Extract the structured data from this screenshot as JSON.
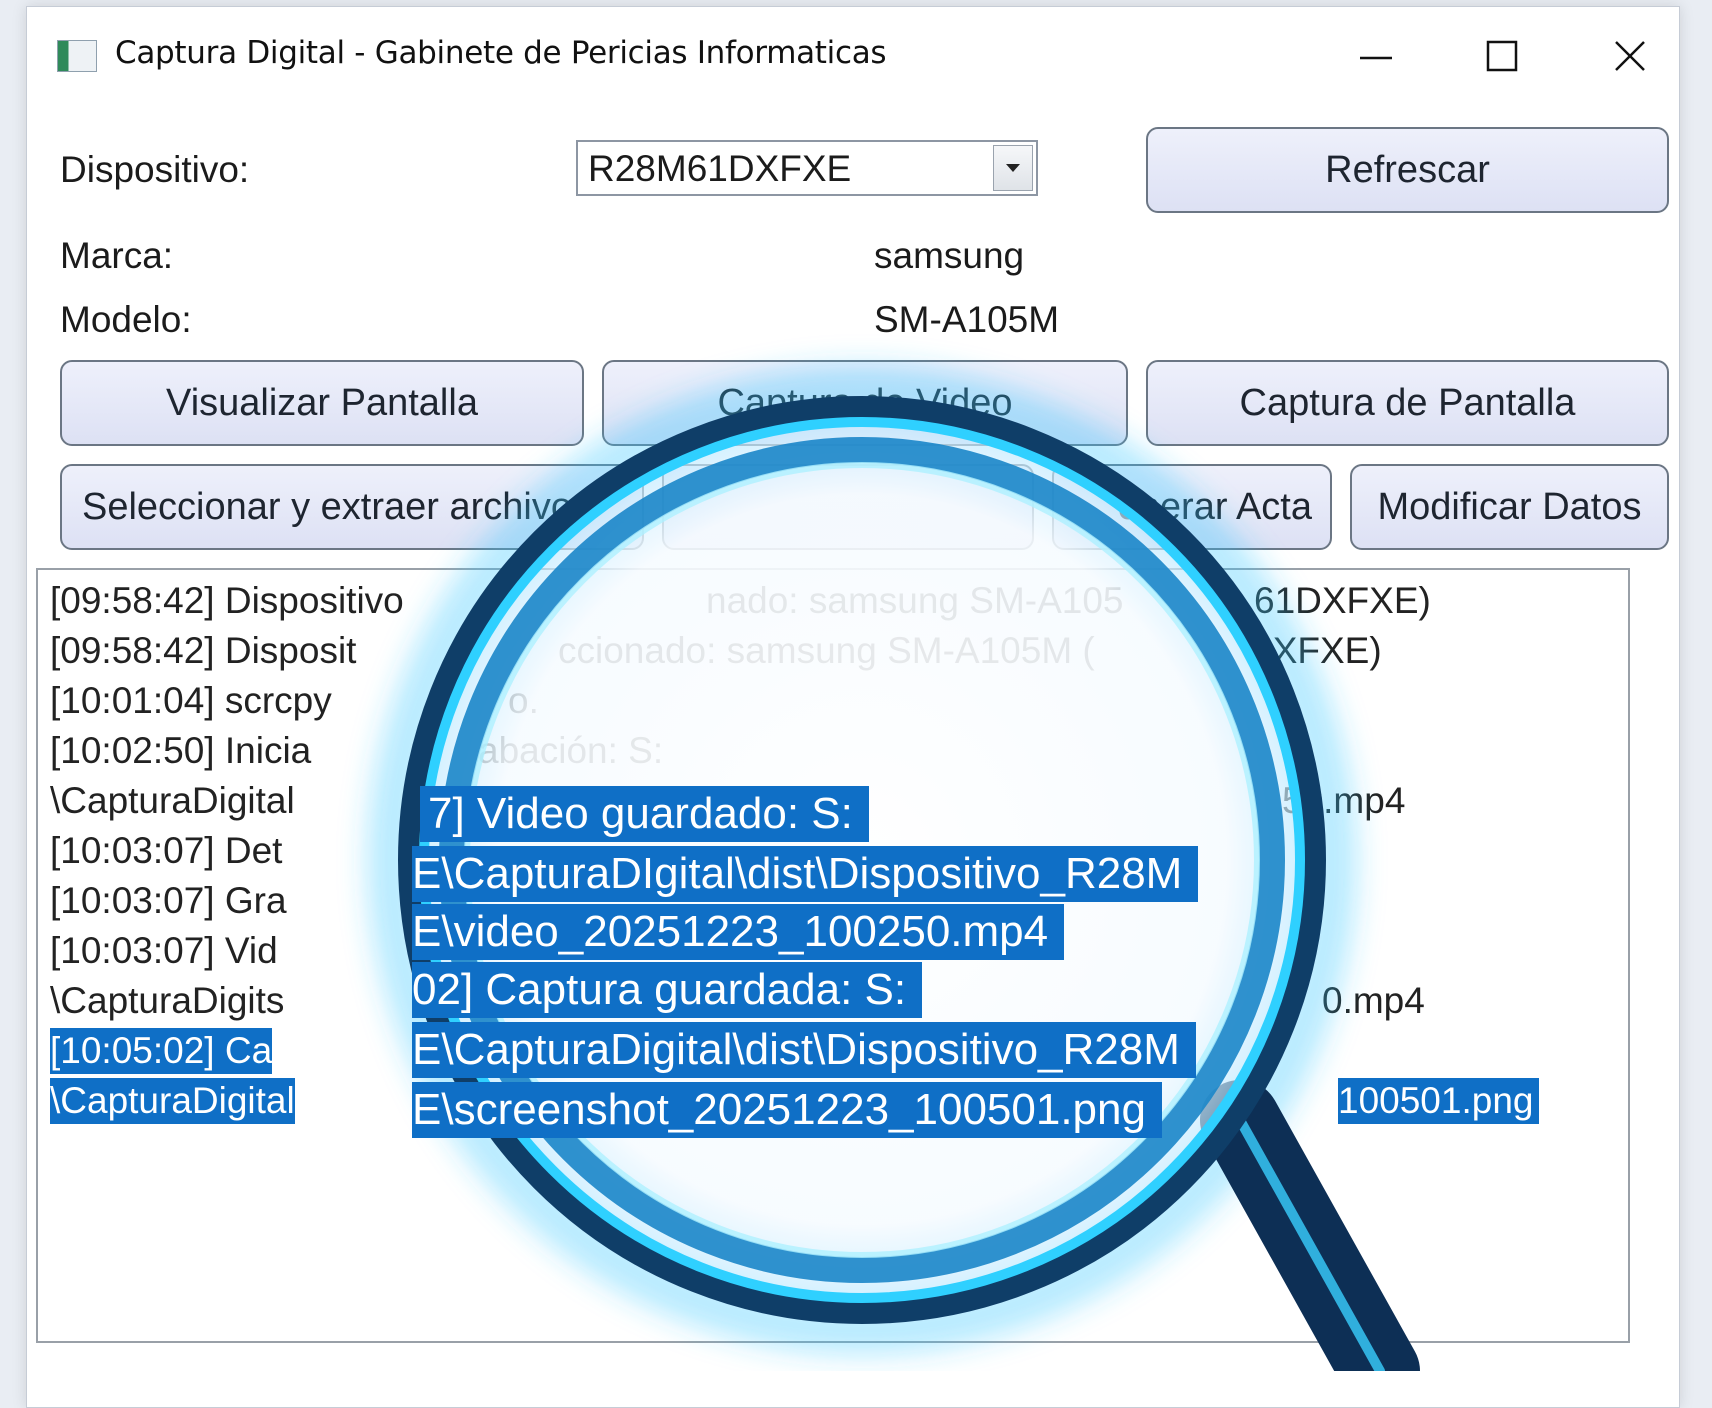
{
  "window": {
    "title": "Captura Digital - Gabinete de Pericias Informaticas"
  },
  "device": {
    "label": "Dispositivo:",
    "selected": "R28M61DXFXE",
    "refresh_label": "Refrescar"
  },
  "brand": {
    "label": "Marca:",
    "value": "samsung"
  },
  "model": {
    "label": "Modelo:",
    "value": "SM-A105M"
  },
  "actions_row1": {
    "view_screen": "Visualizar Pantalla",
    "video_capture": "Captura de Video",
    "screen_capture": "Captura de Pantalla"
  },
  "actions_row2": {
    "select_extract": "Seleccionar y extraer archivo",
    "generate_act": "enerar Acta",
    "modify_data": "Modificar Datos"
  },
  "log": {
    "lines": [
      "[09:58:42] Dispositivo",
      "nado: samsung SM-A105",
      "61DXFXE)",
      "[09:58:42] Disposit",
      "ccionado: samsung SM-A105M (",
      "DXFXE)",
      "[10:01:04] scrcpy",
      "o.",
      "[10:02:50] Inicia",
      "abación: S:",
      "\\CapturaDigital",
      "50.mp4",
      "[10:03:07] Det",
      "[10:03:07] Gra",
      "[10:03:07] Vid",
      "\\CapturaDigits",
      "0.mp4",
      "[10:05:02] Ca",
      "\\CapturaDigital",
      "100501.png"
    ],
    "magnified": [
      "7] Video guardado: S:",
      "E\\CapturaDIgital\\dist\\Dispositivo_R28M",
      "E\\video_20251223_100250.mp4",
      "02] Captura guardada: S:",
      "E\\CapturaDigital\\dist\\Dispositivo_R28M",
      "E\\screenshot_20251223_100501.png"
    ]
  },
  "colors": {
    "selection": "#0f6fc6",
    "glow": "#1ec8ff",
    "button_face": "#e3e6f7"
  }
}
